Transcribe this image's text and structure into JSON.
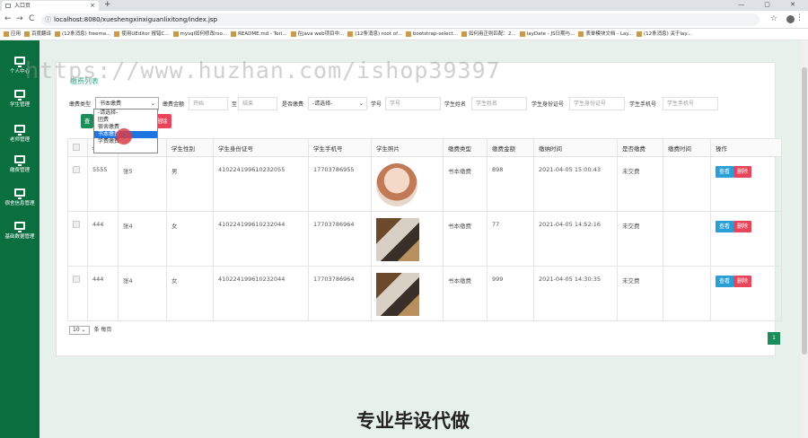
{
  "browser": {
    "tab_title": "入口页",
    "tab_close": "×",
    "new_tab": "+",
    "window_controls": "— ▢ ✕",
    "url": "localhost:8080/xueshengxinxiguanlixitong/index.jsp",
    "back": "←",
    "forward": "→",
    "reload": "C",
    "star": "☆",
    "menu": "⋮",
    "bookmarks": [
      "应用",
      "百度翻译",
      "(12条消息) freema...",
      "使用UEditor 报错C...",
      "mysql如何修改roo...",
      "README.md - Teri...",
      "在java web项目中...",
      "(12条消息) root of...",
      "bootstrap-select...",
      "如何用正则匹配：2...",
      "layDate - JS日期与...",
      "表单模块文档 - Lay...",
      "(12条消息) 关于lay..."
    ]
  },
  "sidebar": {
    "items": [
      "个人中心",
      "学生管理",
      "老师管理",
      "缴费管理",
      "宿舍信息管理",
      "基础数据管理"
    ]
  },
  "panel": {
    "title": "缴费列表",
    "filters": {
      "type_label": "缴费类型",
      "type_selected": "书本缴费",
      "amount_label": "缴费金额",
      "amount_start_placeholder": "开始",
      "amount_sep": "至",
      "amount_end_placeholder": "结束",
      "paid_label": "是否缴费",
      "paid_selected": "-请选择-",
      "xuehao_label": "学号",
      "xuehao_placeholder": "学号",
      "name_label": "学生姓名",
      "name_placeholder": "学生姓名",
      "idcard_label": "学生身份证号",
      "idcard_placeholder": "学生身份证号",
      "phone_label": "学生手机号",
      "phone_placeholder": "学生手机号"
    },
    "buttons": {
      "search": "查",
      "delete": "删除"
    },
    "dropdown_options": [
      "-请选择-",
      "团费",
      "宿舍缴费",
      "书本缴费",
      "学费缴费"
    ],
    "dropdown_selected_index": 3,
    "columns": [
      "",
      "学号",
      "学生姓名",
      "学生性别",
      "学生身份证号",
      "学生手机号",
      "学生照片",
      "缴费类型",
      "缴费金额",
      "缴纳时间",
      "是否缴费",
      "缴费时间",
      "操作"
    ],
    "rows": [
      {
        "xuehao": "5555",
        "name": "张5",
        "gender": "男",
        "idcard": "410224199610232055",
        "phone": "17703786955",
        "photo": "avatar",
        "type": "书本缴费",
        "amount": "898",
        "time": "2021-04-05 15:00:43",
        "paid": "未交费",
        "paytime": ""
      },
      {
        "xuehao": "444",
        "name": "张4",
        "gender": "女",
        "idcard": "410224199610232044",
        "phone": "17703786964",
        "photo": "cat",
        "type": "书本缴费",
        "amount": "77",
        "time": "2021-04-05 14:52:16",
        "paid": "未交费",
        "paytime": ""
      },
      {
        "xuehao": "444",
        "name": "张4",
        "gender": "女",
        "idcard": "410224199610232044",
        "phone": "17703786964",
        "photo": "cat",
        "type": "书本缴费",
        "amount": "999",
        "time": "2021-04-05 14:30:35",
        "paid": "未交费",
        "paytime": ""
      }
    ],
    "row_actions": {
      "view": "查看",
      "delete": "删除"
    },
    "pager": {
      "page_size": "10",
      "suffix": "条 每页",
      "current_page": "1"
    }
  },
  "overlay": {
    "watermark": "https://www.huzhan.com/ishop39397",
    "bottom_text": "专业毕设代做"
  },
  "colors": {
    "sidebar": "#0b6e3f",
    "accent_green": "#1a8d5a",
    "view_button": "#2a9fd6",
    "delete_button": "#e8445a"
  }
}
